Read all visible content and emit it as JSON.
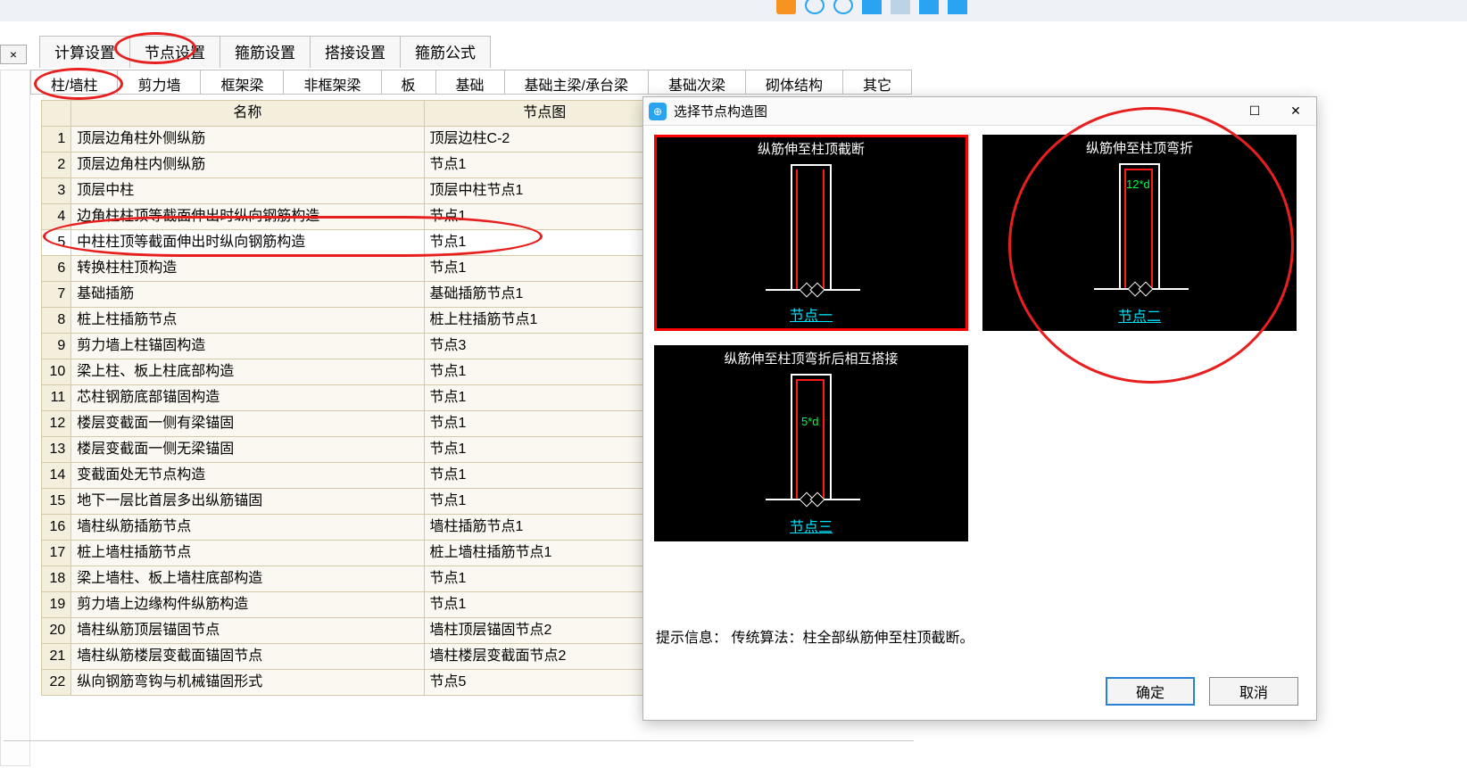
{
  "top_close_glyph": "×",
  "main_tabs": [
    {
      "label": "计算设置"
    },
    {
      "label": "节点设置"
    },
    {
      "label": "箍筋设置"
    },
    {
      "label": "搭接设置"
    },
    {
      "label": "箍筋公式"
    }
  ],
  "sub_tabs": [
    {
      "label": "柱/墙柱"
    },
    {
      "label": "剪力墙"
    },
    {
      "label": "框架梁"
    },
    {
      "label": "非框架梁"
    },
    {
      "label": "板"
    },
    {
      "label": "基础"
    },
    {
      "label": "基础主梁/承台梁"
    },
    {
      "label": "基础次梁"
    },
    {
      "label": "砌体结构"
    },
    {
      "label": "其它"
    }
  ],
  "table": {
    "col_name_header": "名称",
    "col_node_header": "节点图",
    "rows": [
      {
        "n": "1",
        "name": "顶层边角柱外侧纵筋",
        "node": "顶层边柱C-2"
      },
      {
        "n": "2",
        "name": "顶层边角柱内侧纵筋",
        "node": "节点1"
      },
      {
        "n": "3",
        "name": "顶层中柱",
        "node": "顶层中柱节点1"
      },
      {
        "n": "4",
        "name": "边角柱柱顶等截面伸出时纵向钢筋构造",
        "node": "节点1"
      },
      {
        "n": "5",
        "name": "中柱柱顶等截面伸出时纵向钢筋构造",
        "node": "节点1"
      },
      {
        "n": "6",
        "name": "转换柱柱顶构造",
        "node": "节点1"
      },
      {
        "n": "7",
        "name": "基础插筋",
        "node": "基础插筋节点1"
      },
      {
        "n": "8",
        "name": "桩上柱插筋节点",
        "node": "桩上柱插筋节点1"
      },
      {
        "n": "9",
        "name": "剪力墙上柱锚固构造",
        "node": "节点3"
      },
      {
        "n": "10",
        "name": "梁上柱、板上柱底部构造",
        "node": "节点1"
      },
      {
        "n": "11",
        "name": "芯柱钢筋底部锚固构造",
        "node": "节点1"
      },
      {
        "n": "12",
        "name": "楼层变截面一侧有梁锚固",
        "node": "节点1"
      },
      {
        "n": "13",
        "name": "楼层变截面一侧无梁锚固",
        "node": "节点1"
      },
      {
        "n": "14",
        "name": "变截面处无节点构造",
        "node": "节点1"
      },
      {
        "n": "15",
        "name": "地下一层比首层多出纵筋锚固",
        "node": "节点1"
      },
      {
        "n": "16",
        "name": "墙柱纵筋插筋节点",
        "node": "墙柱插筋节点1"
      },
      {
        "n": "17",
        "name": "桩上墙柱插筋节点",
        "node": "桩上墙柱插筋节点1"
      },
      {
        "n": "18",
        "name": "梁上墙柱、板上墙柱底部构造",
        "node": "节点1"
      },
      {
        "n": "19",
        "name": "剪力墙上边缘构件纵筋构造",
        "node": "节点1"
      },
      {
        "n": "20",
        "name": "墙柱纵筋顶层锚固节点",
        "node": "墙柱顶层锚固节点2"
      },
      {
        "n": "21",
        "name": "墙柱纵筋楼层变截面锚固节点",
        "node": "墙柱楼层变截面节点2"
      },
      {
        "n": "22",
        "name": "纵向钢筋弯钩与机械锚固形式",
        "node": "节点5"
      }
    ],
    "selected_index": 4
  },
  "dialog": {
    "icon_glyph": "⊕",
    "title": "选择节点构造图",
    "maximize_glyph": "☐",
    "close_glyph": "✕",
    "thumbs": [
      {
        "title": "纵筋伸至柱顶截断",
        "caption": "节点一",
        "selected": true,
        "dim": ""
      },
      {
        "title": "纵筋伸至柱顶弯折",
        "caption": "节点二",
        "selected": false,
        "dim": "12*d"
      },
      {
        "title": "纵筋伸至柱顶弯折后相互搭接",
        "caption": "节点三",
        "selected": false,
        "dim": "5*d"
      }
    ],
    "hint_label": "提示信息：",
    "hint_text": "传统算法：柱全部纵筋伸至柱顶截断。",
    "ok": "确定",
    "cancel": "取消"
  }
}
